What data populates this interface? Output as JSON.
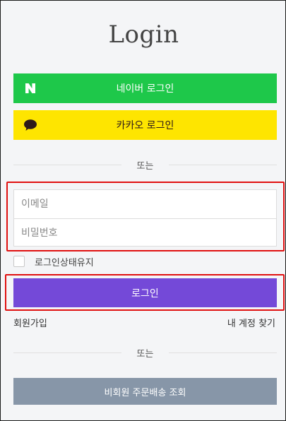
{
  "title": "Login",
  "social": {
    "naver_label": "네이버 로그인",
    "kakao_label": "카카오 로그인",
    "naver_color": "#1ec84a",
    "kakao_color": "#fee500"
  },
  "divider_text": "또는",
  "form": {
    "email_placeholder": "이메일",
    "password_placeholder": "비밀번호",
    "keep_login_label": "로그인상태유지",
    "login_button_label": "로그인",
    "login_button_color": "#7449d8"
  },
  "links": {
    "signup": "회원가입",
    "find_account": "내 계정 찾기"
  },
  "guest_order_label": "비회원 주문배송 조회",
  "highlight_color": "#e01010"
}
